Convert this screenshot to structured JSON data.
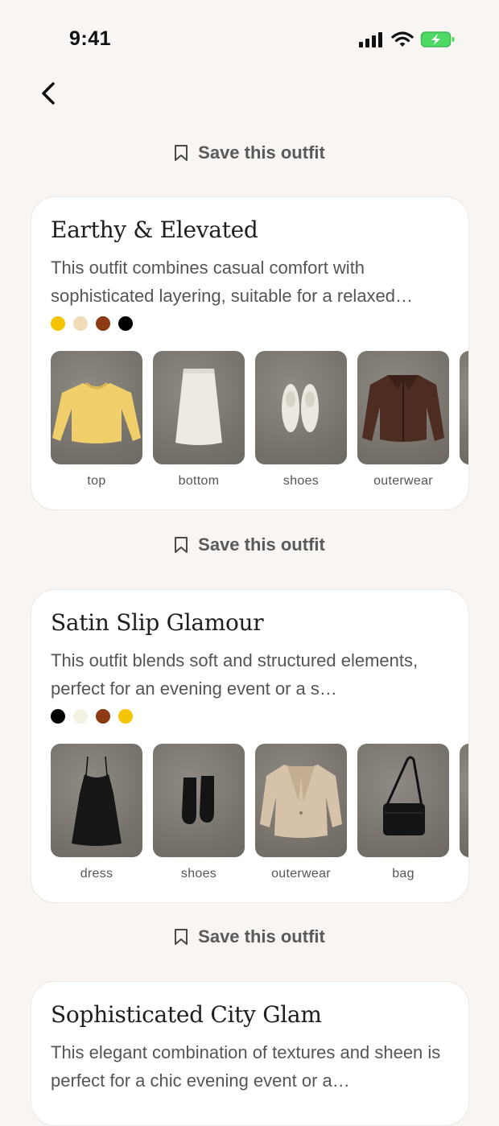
{
  "status": {
    "time": "9:41"
  },
  "save_label": "Save this outfit",
  "outfits": [
    {
      "title": "Earthy & Elevated",
      "description": "This outfit combines casual comfort with sophisticated layering, suitable for a relaxed…",
      "colors": [
        "#f5c400",
        "#f1dcb8",
        "#8b3a12",
        "#000000"
      ],
      "items": [
        {
          "label": "top",
          "icon": "yellow-sweater-image"
        },
        {
          "label": "bottom",
          "icon": "white-skirt-image"
        },
        {
          "label": "shoes",
          "icon": "white-sneakers-image"
        },
        {
          "label": "outerwear",
          "icon": "brown-leather-jacket-image"
        }
      ]
    },
    {
      "title": "Satin Slip Glamour",
      "description": "This outfit blends soft and structured elements, perfect for an evening event or a s…",
      "colors": [
        "#000000",
        "#f3f1df",
        "#8b3a12",
        "#f5c400"
      ],
      "items": [
        {
          "label": "dress",
          "icon": "black-slip-dress-image"
        },
        {
          "label": "shoes",
          "icon": "black-ankle-boots-image"
        },
        {
          "label": "outerwear",
          "icon": "beige-blazer-image"
        },
        {
          "label": "bag",
          "icon": "black-crossbody-bag-image"
        }
      ]
    },
    {
      "title": "Sophisticated City Glam",
      "description": "This elegant combination of textures and sheen is perfect for a chic evening event or a…"
    }
  ]
}
